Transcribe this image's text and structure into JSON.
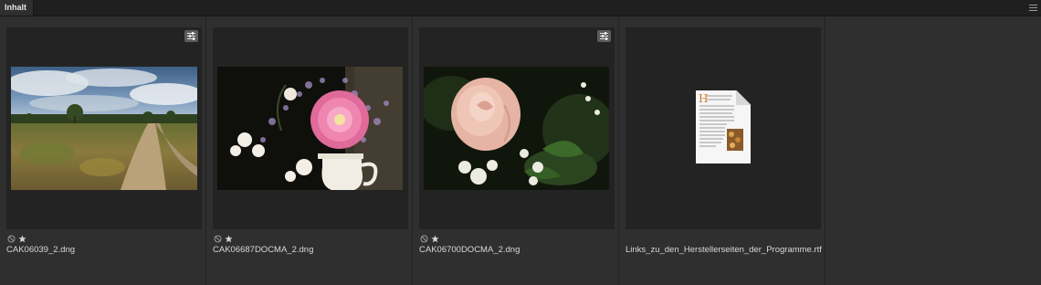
{
  "panel": {
    "tab_label": "Inhalt"
  },
  "items": [
    {
      "filename": "CAK06039_2.dng",
      "has_adjustments": true,
      "rating_icons": [
        "no-flag-icon",
        "star-icon"
      ],
      "image": "landscape-heath-path"
    },
    {
      "filename": "CAK06687DOCMA_2.dng",
      "has_adjustments": false,
      "rating_icons": [
        "no-flag-icon",
        "star-icon"
      ],
      "image": "flower-bouquet-pink-gerbera"
    },
    {
      "filename": "CAK06700DOCMA_2.dng",
      "has_adjustments": true,
      "rating_icons": [
        "no-flag-icon",
        "star-icon"
      ],
      "image": "pink-rose-white-flowers"
    },
    {
      "filename": "Links_zu_den_Herstellerseiten_der_Programme.rtf",
      "has_adjustments": false,
      "rating_icons": [],
      "image": "rtf-document-icon"
    }
  ]
}
